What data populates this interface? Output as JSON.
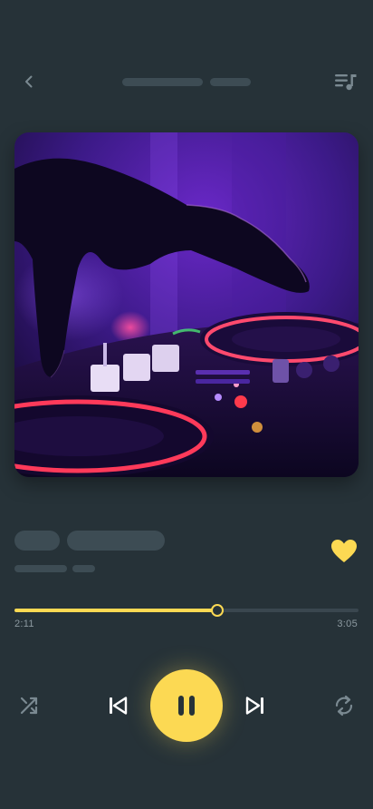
{
  "header": {
    "back_icon": "chevron-left-icon",
    "queue_icon": "playlist-music-icon"
  },
  "track": {
    "liked": true,
    "like_icon": "heart-icon"
  },
  "playback": {
    "elapsed": "2:11",
    "total": "3:05",
    "progress_fraction": 0.59,
    "state": "playing"
  },
  "controls": {
    "shuffle_icon": "shuffle-icon",
    "previous_icon": "skip-previous-icon",
    "play_pause_icon": "pause-icon",
    "next_icon": "skip-next-icon",
    "repeat_icon": "repeat-icon"
  },
  "colors": {
    "background": "#263238",
    "accent": "#fcd953",
    "placeholder": "#3d4c54",
    "icon_muted": "#7a8991",
    "icon_light": "#ffffff"
  }
}
